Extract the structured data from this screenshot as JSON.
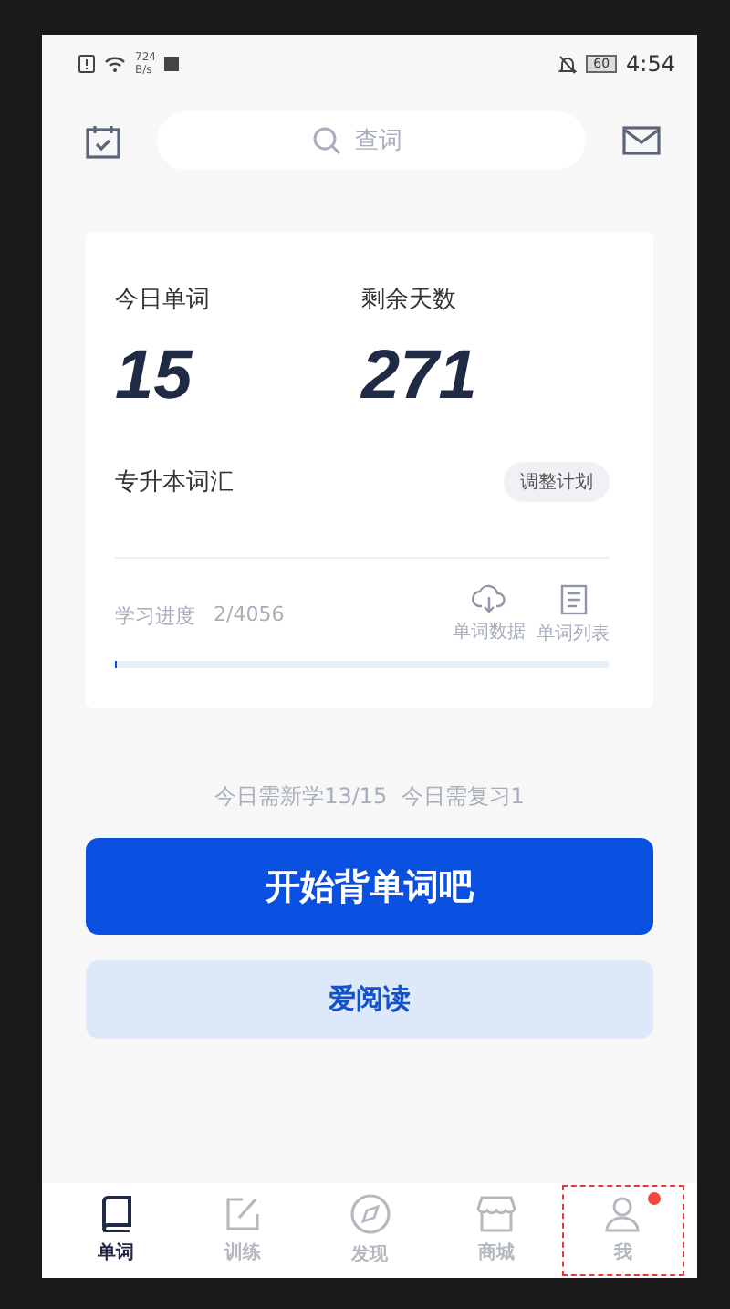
{
  "status_bar": {
    "net_speed_value": "724",
    "net_speed_unit": "B/s",
    "battery": "60",
    "time": "4:54"
  },
  "search": {
    "placeholder": "查词"
  },
  "plan": {
    "today_label": "今日单词",
    "today_value": "15",
    "days_label": "剩余天数",
    "days_value": "271",
    "book": "专升本词汇",
    "adjust_button": "调整计划",
    "progress_label": "学习进度",
    "progress_value": "2/4056",
    "level": 0.0005,
    "actions": [
      {
        "label": "单词数据",
        "kind": "cloud"
      },
      {
        "label": "单词列表",
        "kind": "list"
      }
    ]
  },
  "summary": "今日需新学13/15  今日需复习1",
  "start_button": "开始背单词吧",
  "read_button": "爱阅读",
  "tabs": [
    {
      "label": "单词",
      "kind": "book",
      "selected": true,
      "badge": false,
      "highlighted": false
    },
    {
      "label": "训练",
      "kind": "edit",
      "selected": false,
      "badge": false,
      "highlighted": false
    },
    {
      "label": "发现",
      "kind": "compass",
      "selected": false,
      "badge": false,
      "highlighted": false
    },
    {
      "label": "商城",
      "kind": "shop",
      "selected": false,
      "badge": false,
      "highlighted": false
    },
    {
      "label": "我",
      "kind": "person",
      "selected": false,
      "badge": true,
      "highlighted": true
    }
  ]
}
